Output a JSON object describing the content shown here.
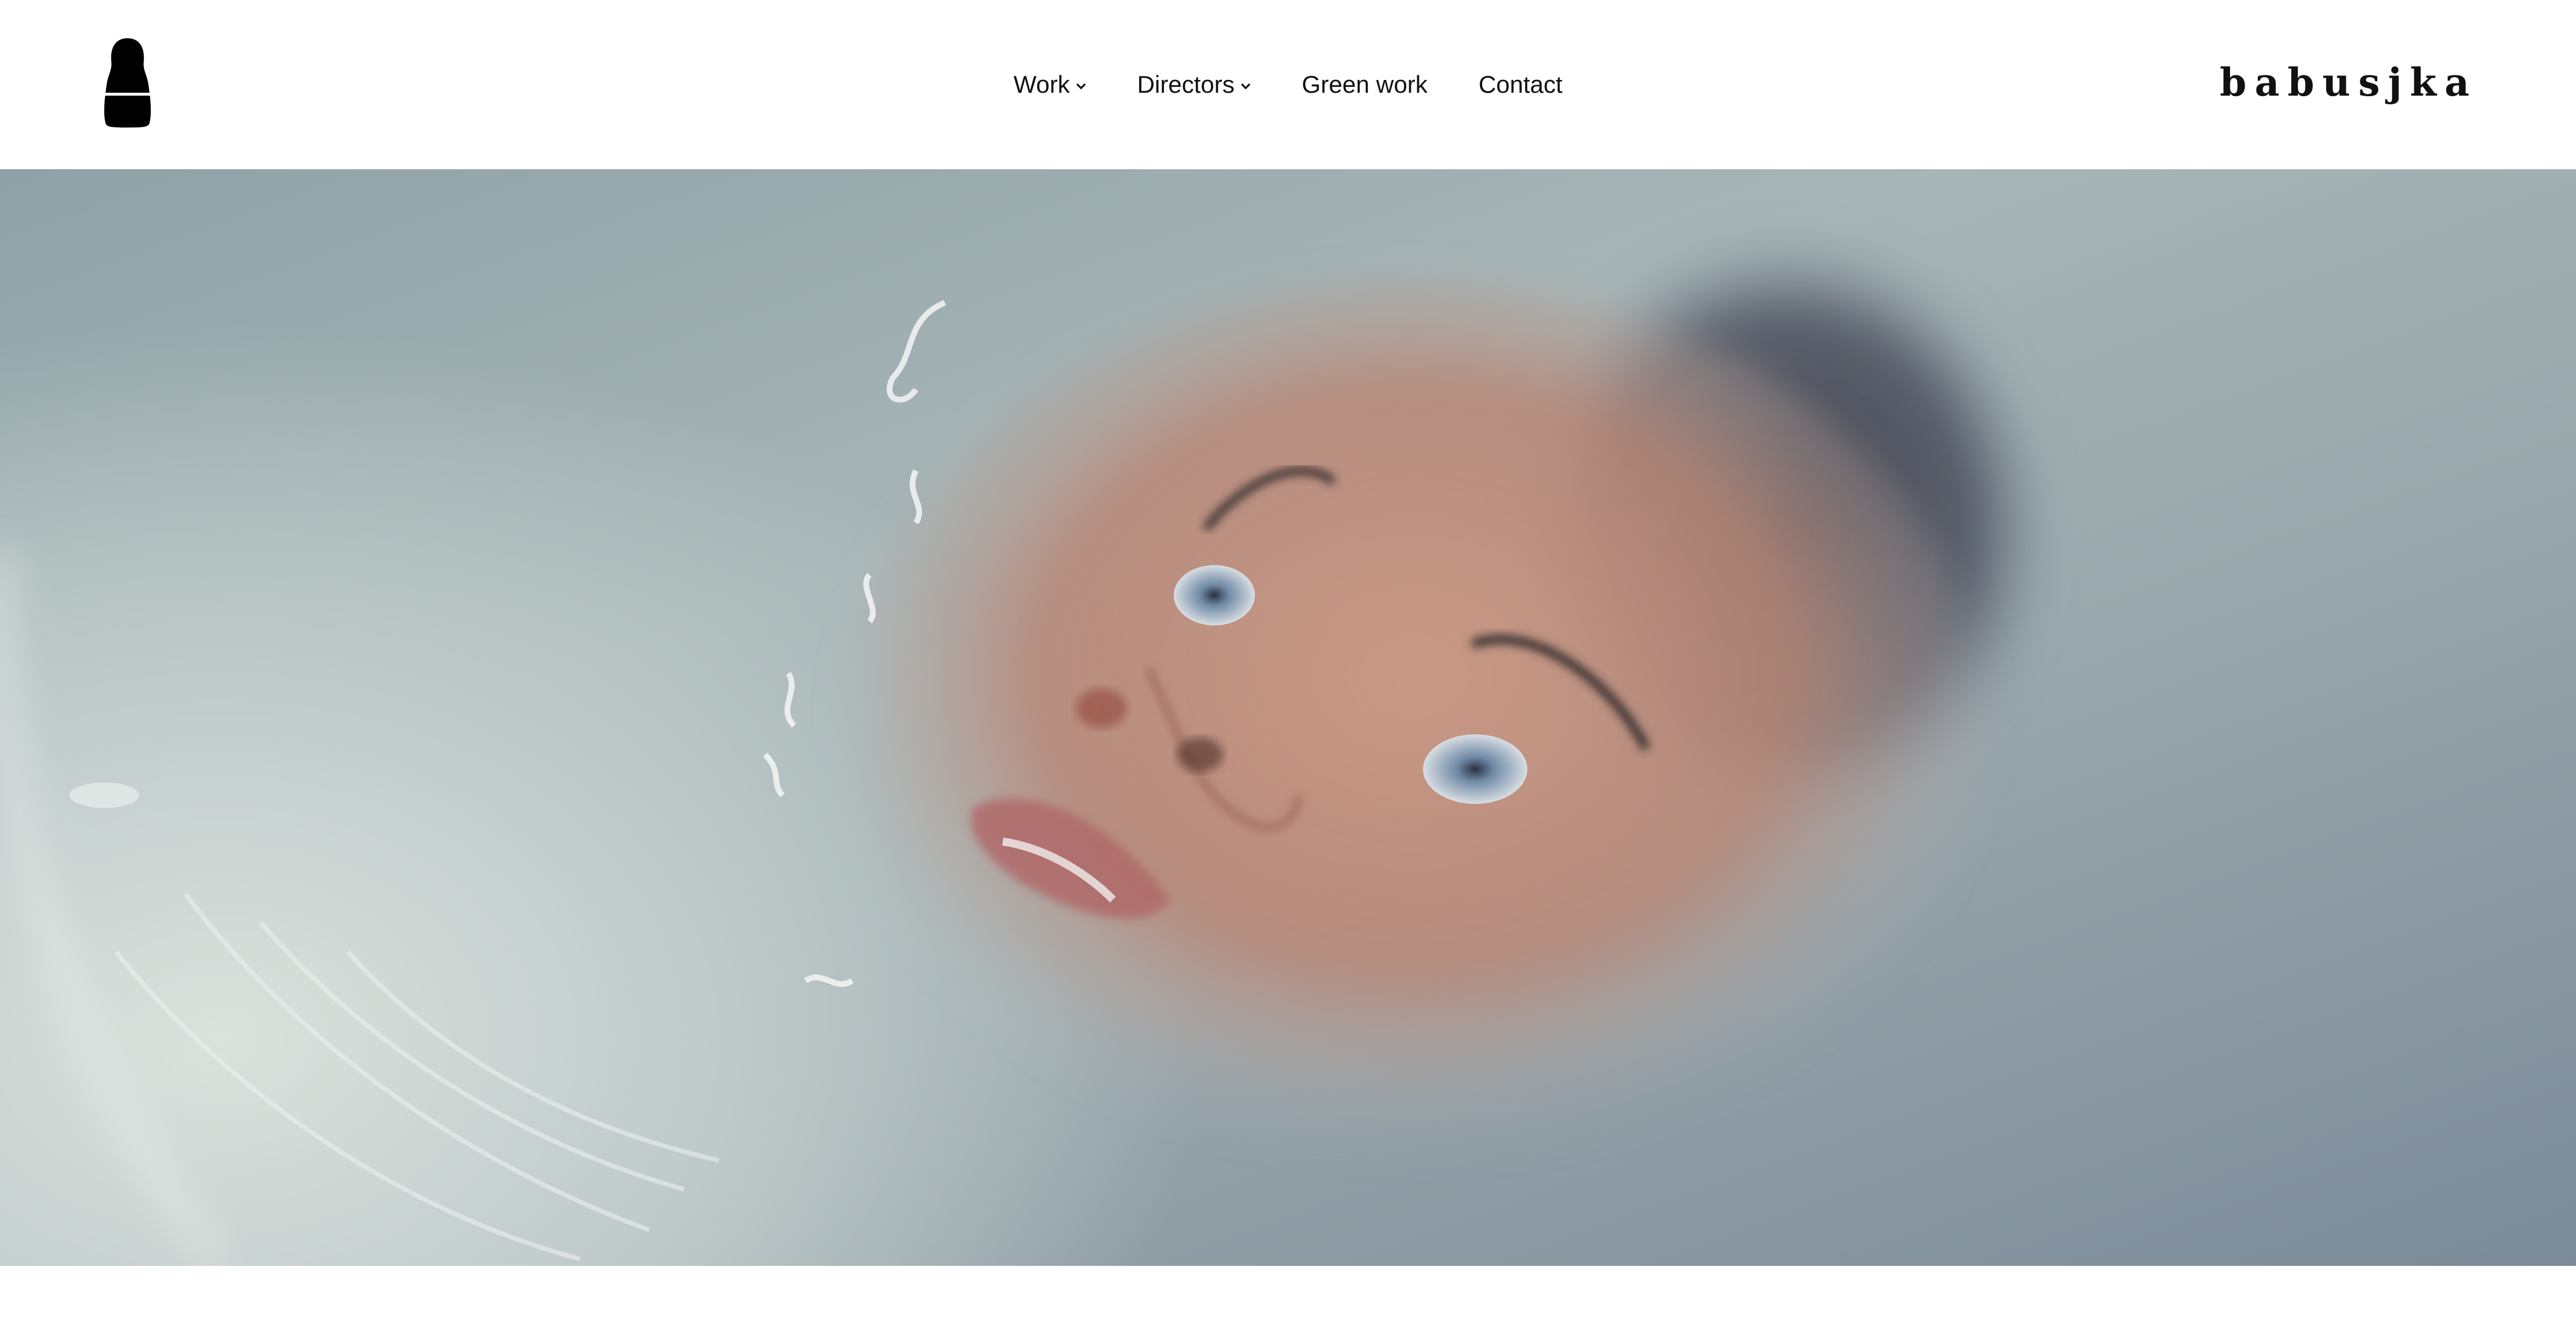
{
  "header": {
    "logo_icon": "matryoshka-doll-icon",
    "nav": [
      {
        "label": "Work",
        "has_dropdown": true
      },
      {
        "label": "Directors",
        "has_dropdown": true
      },
      {
        "label": "Green work",
        "has_dropdown": false
      },
      {
        "label": "Contact",
        "has_dropdown": false
      }
    ],
    "wordmark": "babusjka"
  },
  "hero": {
    "image": "woman-floating-in-milky-water"
  },
  "colors": {
    "text": "#111111",
    "background": "#ffffff"
  }
}
